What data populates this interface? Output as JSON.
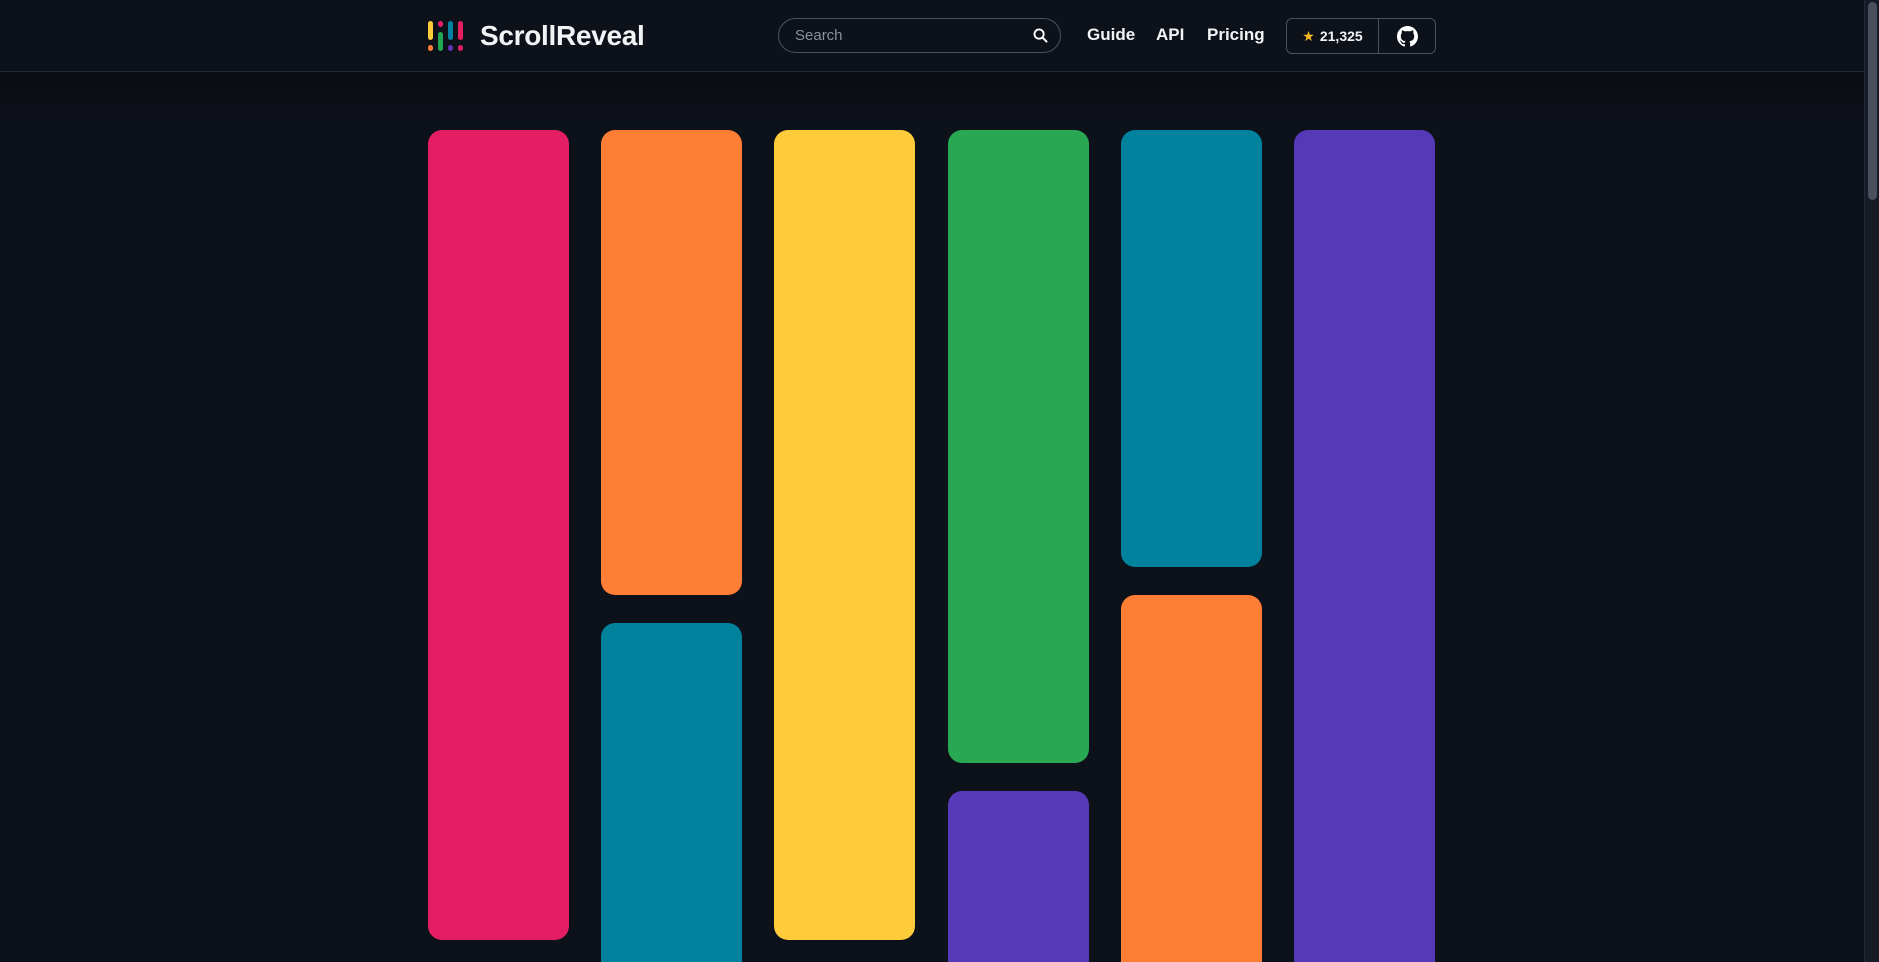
{
  "brand": {
    "name": "ScrollReveal",
    "mark_colors": [
      "#fecb3b",
      "#e31e63",
      "#22a651",
      "#0082a0",
      "#5e34b7",
      "#ff7e35"
    ]
  },
  "search": {
    "placeholder": "Search",
    "icon": "search-icon"
  },
  "nav": {
    "items": [
      {
        "label": "Guide"
      },
      {
        "label": "API"
      },
      {
        "label": "Pricing"
      }
    ]
  },
  "github": {
    "stars": "21,325",
    "star_icon": "star-icon",
    "icon": "github-icon"
  },
  "colors": {
    "background": "#0d111a",
    "pink": "#e31e63",
    "orange": "#ff7e35",
    "yellow": "#fecb3b",
    "green": "#28a852",
    "teal": "#00819c",
    "purple": "#5639b7"
  },
  "tile_columns": [
    [
      "pink"
    ],
    [
      "orange",
      "teal"
    ],
    [
      "yellow"
    ],
    [
      "green",
      "purple"
    ],
    [
      "teal",
      "orange"
    ],
    [
      "purple"
    ]
  ]
}
